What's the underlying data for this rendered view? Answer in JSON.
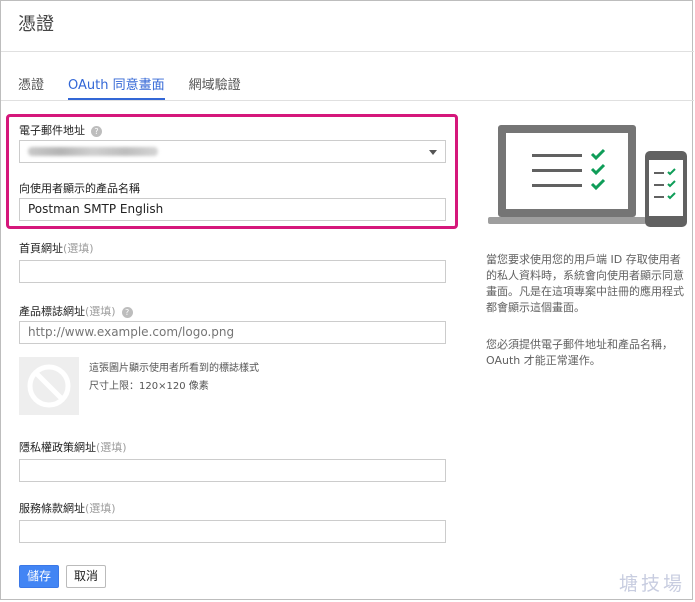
{
  "page": {
    "title": "憑證"
  },
  "tabs": [
    {
      "label": "憑證",
      "active": false
    },
    {
      "label": "OAuth 同意畫面",
      "active": true
    },
    {
      "label": "網域驗證",
      "active": false
    }
  ],
  "form": {
    "email": {
      "label": "電子郵件地址",
      "value_visible": false
    },
    "product_name": {
      "label": "向使用者顯示的產品名稱",
      "value": "Postman SMTP English"
    },
    "homepage": {
      "label": "首頁網址",
      "optional": "(選填)",
      "value": ""
    },
    "logo": {
      "label": "產品標誌網址",
      "optional": "(選填)",
      "placeholder": "http://www.example.com/logo.png",
      "hint_line1": "這張圖片顯示使用者所看到的標誌樣式",
      "hint_line2": "尺寸上限：120×120 像素"
    },
    "privacy": {
      "label": "隱私權政策網址",
      "optional": "(選填)",
      "value": ""
    },
    "terms": {
      "label": "服務條款網址",
      "optional": "(選填)",
      "value": ""
    }
  },
  "buttons": {
    "save": "儲存",
    "cancel": "取消"
  },
  "side": {
    "paragraph1": "當您要求使用您的用戶端 ID 存取使用者的私人資料時，系統會向使用者顯示同意畫面。凡是在這項專案中註冊的應用程式都會顯示這個畫面。",
    "paragraph2": "您必須提供電子郵件地址和產品名稱，OAuth 才能正常運作。"
  },
  "watermark": "塘技場",
  "colors": {
    "accent": "#3367d6",
    "primary_button": "#4285f4",
    "highlight": "#d5177b",
    "check": "#0f9d58",
    "device": "#757575"
  },
  "icons": {
    "help": "question-circle-icon",
    "dropdown": "caret-down-icon",
    "no_logo": "prohibited-icon"
  }
}
